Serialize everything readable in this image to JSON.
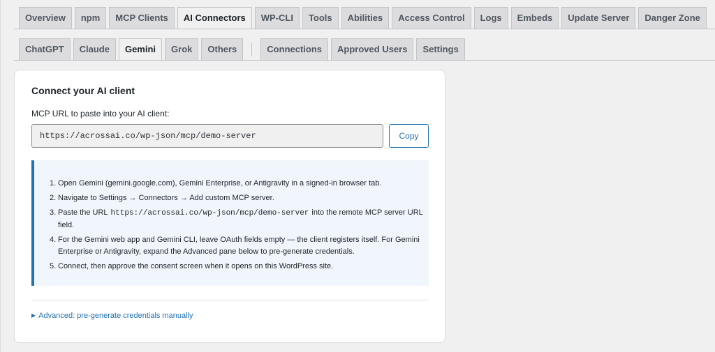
{
  "tabs_primary": [
    {
      "label": "Overview",
      "active": false
    },
    {
      "label": "npm",
      "active": false
    },
    {
      "label": "MCP Clients",
      "active": false
    },
    {
      "label": "AI Connectors",
      "active": true
    },
    {
      "label": "WP-CLI",
      "active": false
    },
    {
      "label": "Tools",
      "active": false
    },
    {
      "label": "Abilities",
      "active": false
    },
    {
      "label": "Access Control",
      "active": false
    },
    {
      "label": "Logs",
      "active": false
    },
    {
      "label": "Embeds",
      "active": false
    },
    {
      "label": "Update Server",
      "active": false
    },
    {
      "label": "Danger Zone",
      "active": false
    }
  ],
  "tabs_secondary": [
    {
      "label": "ChatGPT",
      "active": false
    },
    {
      "label": "Claude",
      "active": false
    },
    {
      "label": "Gemini",
      "active": true
    },
    {
      "label": "Grok",
      "active": false
    },
    {
      "label": "Others",
      "active": false
    },
    {
      "label": "Connections",
      "active": false
    },
    {
      "label": "Approved Users",
      "active": false
    },
    {
      "label": "Settings",
      "active": false
    }
  ],
  "card": {
    "title": "Connect your AI client",
    "url_label": "MCP URL to paste into your AI client:",
    "url_value": "https://acrossai.co/wp-json/mcp/demo-server",
    "copy_label": "Copy",
    "steps": [
      {
        "num": "1.",
        "text": "Open Gemini (gemini.google.com), Gemini Enterprise, or Antigravity in a signed-in browser tab."
      },
      {
        "num": "2.",
        "text": "Navigate to Settings → Connectors → Add custom MCP server."
      },
      {
        "num": "3.",
        "before": "Paste the URL",
        "code": "https://acrossai.co/wp-json/mcp/demo-server",
        "after": "into the remote MCP server URL field."
      },
      {
        "num": "4.",
        "text": "For the Gemini web app and Gemini CLI, leave OAuth fields empty — the client registers itself. For Gemini Enterprise or Antigravity, expand the Advanced pane below to pre-generate credentials."
      },
      {
        "num": "5.",
        "text": "Connect, then approve the consent screen when it opens on this WordPress site."
      }
    ],
    "advanced_label": "Advanced: pre-generate credentials manually",
    "advanced_icon": "triangle-right-icon"
  },
  "colors": {
    "accent": "#2271b1",
    "tab_bg": "#dcdcde",
    "page_bg": "#f0f0f1",
    "notice_bg": "#f0f6fc"
  }
}
